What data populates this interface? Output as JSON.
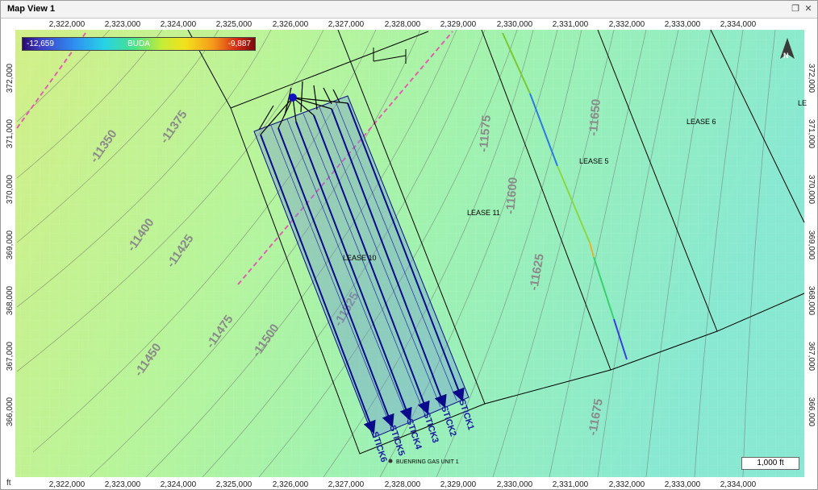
{
  "window": {
    "title": "Map View 1",
    "restore_icon": "restore-icon",
    "close_icon": "close-icon"
  },
  "axes": {
    "unit": "ft",
    "x_ticks": [
      "2,322,000",
      "2,323,000",
      "2,324,000",
      "2,325,000",
      "2,326,000",
      "2,327,000",
      "2,328,000",
      "2,329,000",
      "2,330,000",
      "2,331,000",
      "2,332,000",
      "2,333,000",
      "2,334,000"
    ],
    "y_ticks": [
      "372,000",
      "371,000",
      "370,000",
      "369,000",
      "368,000",
      "367,000",
      "366,000"
    ]
  },
  "colorbar": {
    "min": "-12,659",
    "name": "BUDA",
    "max": "-9,887"
  },
  "contours": [
    "-11350",
    "-11375",
    "-11400",
    "-11425",
    "-11450",
    "-11475",
    "-11500",
    "-11525",
    "-11575",
    "-11600",
    "-11625",
    "-11650",
    "-11675"
  ],
  "leases": [
    "LEASE 10",
    "LEASE 11",
    "LEASE 5",
    "LEASE 6",
    "LE"
  ],
  "wells": [
    "STICK1",
    "STICK2",
    "STICK3",
    "STICK4",
    "STICK5",
    "STICK6"
  ],
  "unit_label": "BUENRING GAS UNIT 1",
  "scale": "1,000 ft",
  "north_icon": "north-arrow-icon",
  "colors": {
    "map_left": "#ccf08a",
    "map_mid": "#a8f2a8",
    "map_right": "#8ee8cc",
    "well_path": "#0a0a8a",
    "lease_line": "#000000",
    "fault": "#e060b0"
  }
}
